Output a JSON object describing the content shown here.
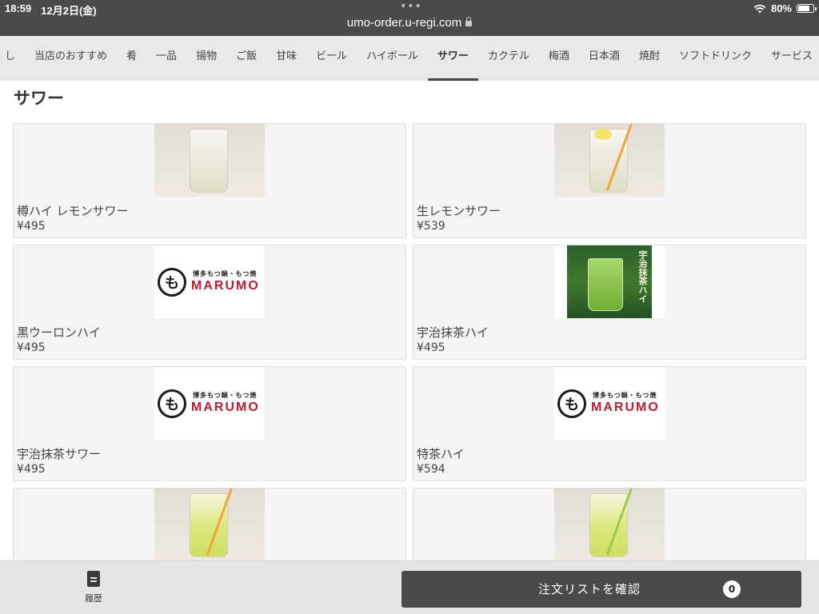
{
  "status_bar": {
    "time": "18:59",
    "date": "12月2日(金)",
    "battery": "80%",
    "battery_level": 0.8
  },
  "browser": {
    "url": "umo-order.u-regi.com"
  },
  "tabs": [
    {
      "label": "し"
    },
    {
      "label": "当店のおすすめ"
    },
    {
      "label": "肴"
    },
    {
      "label": "一品"
    },
    {
      "label": "揚物"
    },
    {
      "label": "ご飯"
    },
    {
      "label": "甘味"
    },
    {
      "label": "ビール"
    },
    {
      "label": "ハイボール"
    },
    {
      "label": "サワー"
    },
    {
      "label": "カクテル"
    },
    {
      "label": "梅酒"
    },
    {
      "label": "日本酒"
    },
    {
      "label": "焼酎"
    },
    {
      "label": "ソフトドリンク"
    },
    {
      "label": "サービス"
    }
  ],
  "active_tab": "サワー",
  "section": {
    "title": "サワー"
  },
  "logo": {
    "mark": "も",
    "sub": "博多もつ鍋・もつ焼",
    "word": "MARUMO"
  },
  "matcha_poster_text": "宇治抹茶ハイ",
  "items": [
    {
      "name": "樽ハイ レモンサワー",
      "price": "¥495",
      "image": "lemon-sour-photo"
    },
    {
      "name": "生レモンサワー",
      "price": "¥539",
      "image": "fresh-lemon-sour-photo"
    },
    {
      "name": "黒ウーロンハイ",
      "price": "¥495",
      "image": "marumo-logo"
    },
    {
      "name": "宇治抹茶ハイ",
      "price": "¥495",
      "image": "matcha-poster"
    },
    {
      "name": "宇治抹茶サワー",
      "price": "¥495",
      "image": "marumo-logo"
    },
    {
      "name": "特茶ハイ",
      "price": "¥594",
      "image": "marumo-logo"
    },
    {
      "name": "",
      "price": "",
      "image": "yellow-sour-photo"
    },
    {
      "name": "",
      "price": "",
      "image": "yellow-sour-photo-2"
    }
  ],
  "bottom_bar": {
    "history_label": "履歴",
    "confirm_label": "注文リストを確認",
    "order_count": "0"
  },
  "colors": {
    "chrome": "#4a4a4a",
    "tab_bar": "#e9e9e9",
    "card_bg": "#f4f4f4",
    "brand_red": "#b81c2e"
  }
}
